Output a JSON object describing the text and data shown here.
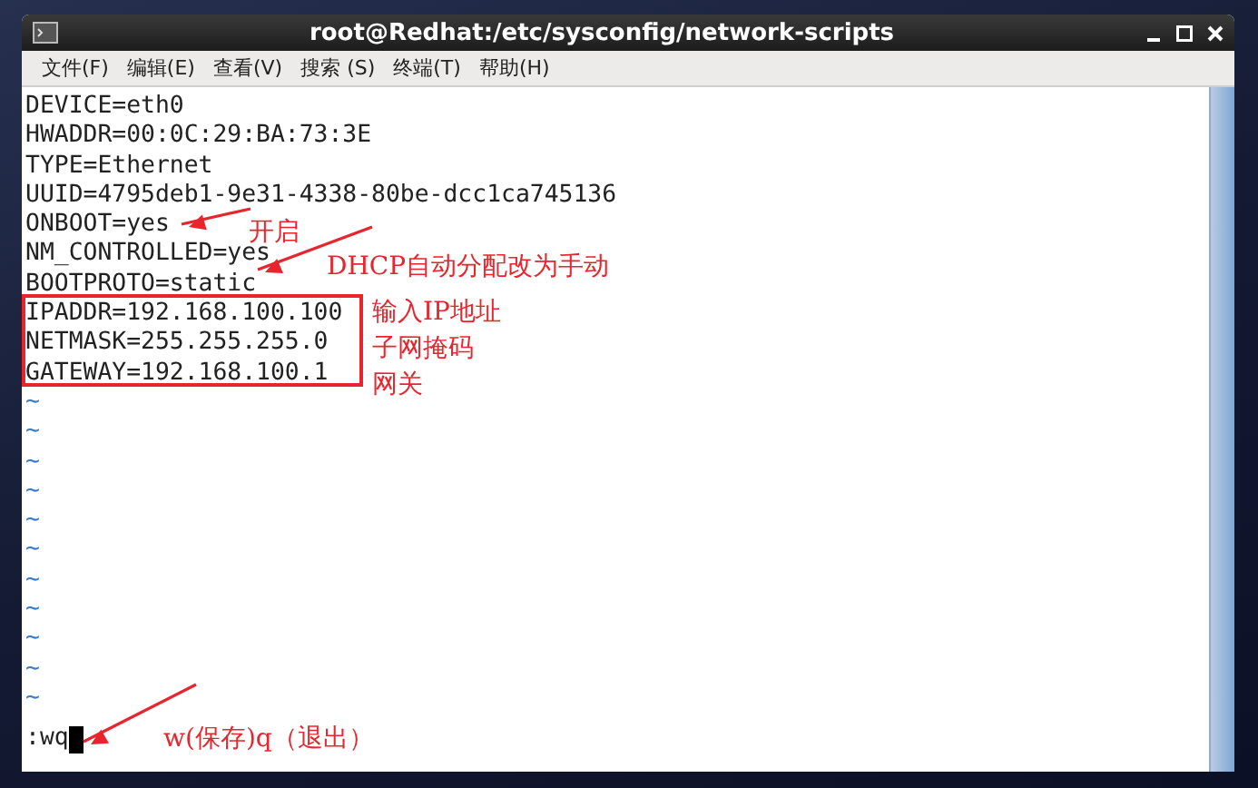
{
  "window": {
    "title": "root@Redhat:/etc/sysconfig/network-scripts"
  },
  "menu": [
    "文件(F)",
    "编辑(E)",
    "查看(V)",
    "搜索 (S)",
    "终端(T)",
    "帮助(H)"
  ],
  "lines": [
    "DEVICE=eth0",
    "HWADDR=00:0C:29:BA:73:3E",
    "TYPE=Ethernet",
    "UUID=4795deb1-9e31-4338-80be-dcc1ca745136",
    "ONBOOT=yes",
    "NM_CONTROLLED=yes",
    "BOOTPROTO=static",
    "IPADDR=192.168.100.100",
    "NETMASK=255.255.255.0",
    "GATEWAY=192.168.100.1"
  ],
  "empty_lines": [
    "~",
    "~",
    "~",
    "~",
    "~",
    "~",
    "~",
    "~",
    "~",
    "~",
    "~"
  ],
  "command": ":wq",
  "annotations": [
    {
      "text": "开启"
    },
    {
      "text": "DHCP自动分配改为手动"
    },
    {
      "text": "输入IP地址"
    },
    {
      "text": "子网掩码"
    },
    {
      "text": "网关"
    },
    {
      "text": "w(保存)q（退出）"
    }
  ]
}
